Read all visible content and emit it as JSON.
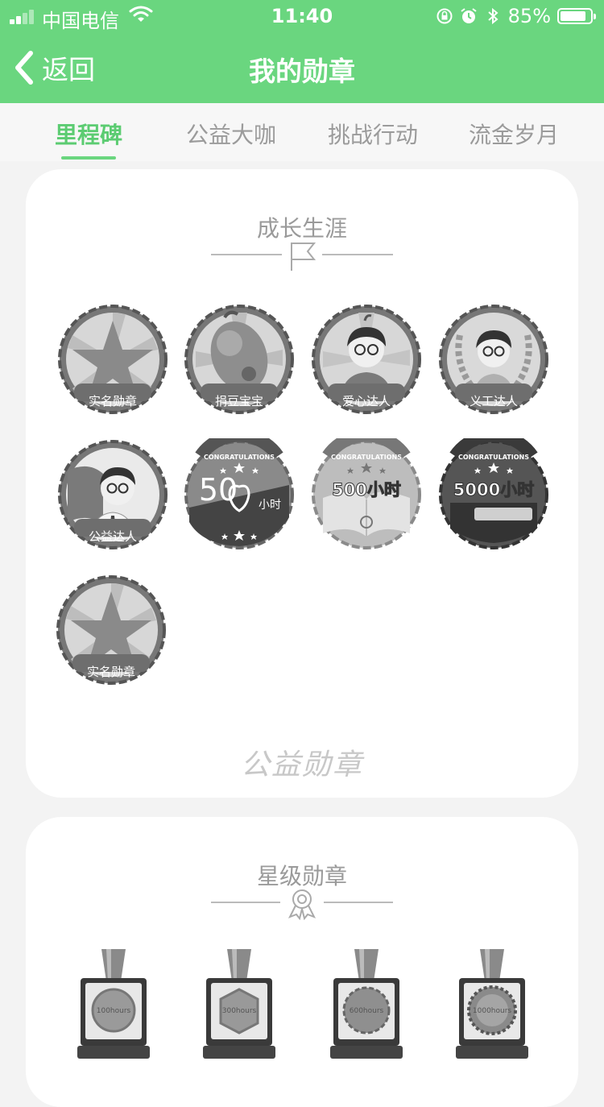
{
  "status_bar": {
    "carrier": "中国电信",
    "time": "11:40",
    "battery": "85%",
    "battery_level": 0.85
  },
  "nav": {
    "back_label": "返回",
    "title": "我的勋章"
  },
  "tabs": [
    {
      "label": "里程碑",
      "active": true
    },
    {
      "label": "公益大咖",
      "active": false
    },
    {
      "label": "挑战行动",
      "active": false
    },
    {
      "label": "流金岁月",
      "active": false
    }
  ],
  "career_section": {
    "title": "成长生涯",
    "badges": [
      {
        "label": "实名勋章",
        "icon": "star-badge-icon"
      },
      {
        "label": "捐豆宝宝",
        "icon": "bean-baby-badge-icon"
      },
      {
        "label": "爱心达人",
        "icon": "caring-person-badge-icon"
      },
      {
        "label": "义工达人",
        "icon": "volunteer-laurel-badge-icon"
      },
      {
        "label": "公益达人",
        "icon": "charity-flag-badge-icon"
      },
      {
        "banner": "CONGRATULATIONS",
        "hours": "50",
        "unit": "小时",
        "icon": "heart-50-hours-badge-icon"
      },
      {
        "banner": "CONGRATULATIONS",
        "hours": "500小时",
        "icon": "book-500-hours-badge-icon"
      },
      {
        "banner": "CONGRATULATIONS",
        "hours": "5000小时",
        "icon": "book-5000-hours-badge-icon"
      },
      {
        "label": "实名勋章",
        "icon": "star-badge-icon"
      }
    ],
    "footer_logo": "公益勋章"
  },
  "star_section": {
    "title": "星级勋章",
    "medals": [
      {
        "text": "100hours",
        "icon": "medal-100-hours-icon"
      },
      {
        "text": "300hours",
        "icon": "medal-300-hours-icon"
      },
      {
        "text": "600hours",
        "icon": "medal-600-hours-icon"
      },
      {
        "text": "1000hours",
        "icon": "medal-1000-hours-icon"
      }
    ]
  }
}
